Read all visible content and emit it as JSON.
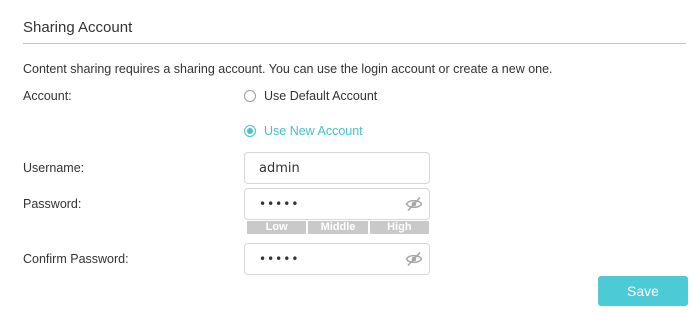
{
  "section": {
    "title": "Sharing Account",
    "description": "Content sharing requires a sharing account. You can use the login account or create a new one."
  },
  "account": {
    "label": "Account:",
    "options": [
      {
        "label": "Use Default Account",
        "selected": false
      },
      {
        "label": "Use New Account",
        "selected": true
      }
    ]
  },
  "username": {
    "label": "Username:",
    "value": "admin"
  },
  "password": {
    "label": "Password:",
    "value": "•••••",
    "visibility_icon": "eye-slash-icon",
    "strength_levels": [
      "Low",
      "Middle",
      "High"
    ]
  },
  "confirm_password": {
    "label": "Confirm Password:",
    "value": "•••••",
    "visibility_icon": "eye-slash-icon"
  },
  "actions": {
    "save_label": "Save"
  },
  "colors": {
    "accent": "#43c3d1",
    "button": "#4ccbd7",
    "strength_bar": "#c9c9c9"
  }
}
